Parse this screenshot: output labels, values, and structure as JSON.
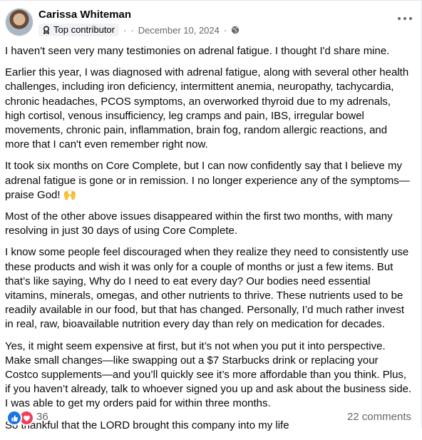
{
  "post": {
    "author": "Carissa Whiteman",
    "badge_label": "Top contributor",
    "separator": "·",
    "date": "December 10, 2024",
    "paragraphs": [
      "I haven't seen very many testimonies on adrenal fatigue. I thought I'd share mine.",
      "Earlier this year, I was diagnosed with adrenal fatigue, along with several other health challenges, including iron deficiency, intermittent anemia, neuropathy, tachycardia, chronic headaches, PCOS symptoms, an overworked thyroid due to my adrenals, high cortisol, venous insufficiency, leg cramps and pain, IBS, irregular bowel movements, chronic pain, inflammation, brain fog, random allergic reactions, and more that I can't even remember right now.",
      "It took six months on Core Complete, but I can now confidently say that I believe my adrenal fatigue is gone or in remission. I no longer experience any of the symptoms—praise God! 🙌",
      "Most of the other above issues disappeared within the first two months, with many resolving in just 30 days of using Core Complete.",
      "I know some people feel discouraged when they realize they need to consistently use these products and wish it was only for a couple of months or just a few items. But that’s like saying, Why do I need to eat every day? Our bodies need essential vitamins, minerals, omegas, and other nutrients to thrive. These nutrients used to be readily available in our food, but that has changed. Personally, I’d much rather invest in real, raw, bioavailable nutrition every day than rely on medication for decades.",
      "Yes, it might seem expensive at first, but it’s not when you put it into perspective. Make small changes—like swapping out a $7 Starbucks drink or replacing your Costco supplements—and you’ll quickly see it’s more affordable than you think. Plus, if you haven’t already, talk to whoever signed you up and ask about the business side. I was able to get my orders paid for within three months.",
      "So thankful that the LORD brought this company into my life"
    ]
  },
  "footer": {
    "reaction_count": "36",
    "comments_label": "22 comments"
  },
  "icons": {
    "badge": "contributor-badge-icon",
    "audience": "globe-icon",
    "more": "more-options-icon",
    "like": "like-icon",
    "love": "love-icon"
  },
  "colors": {
    "like": "#1b74e4",
    "love": "#f33e58",
    "secondary_text": "#65686c"
  }
}
